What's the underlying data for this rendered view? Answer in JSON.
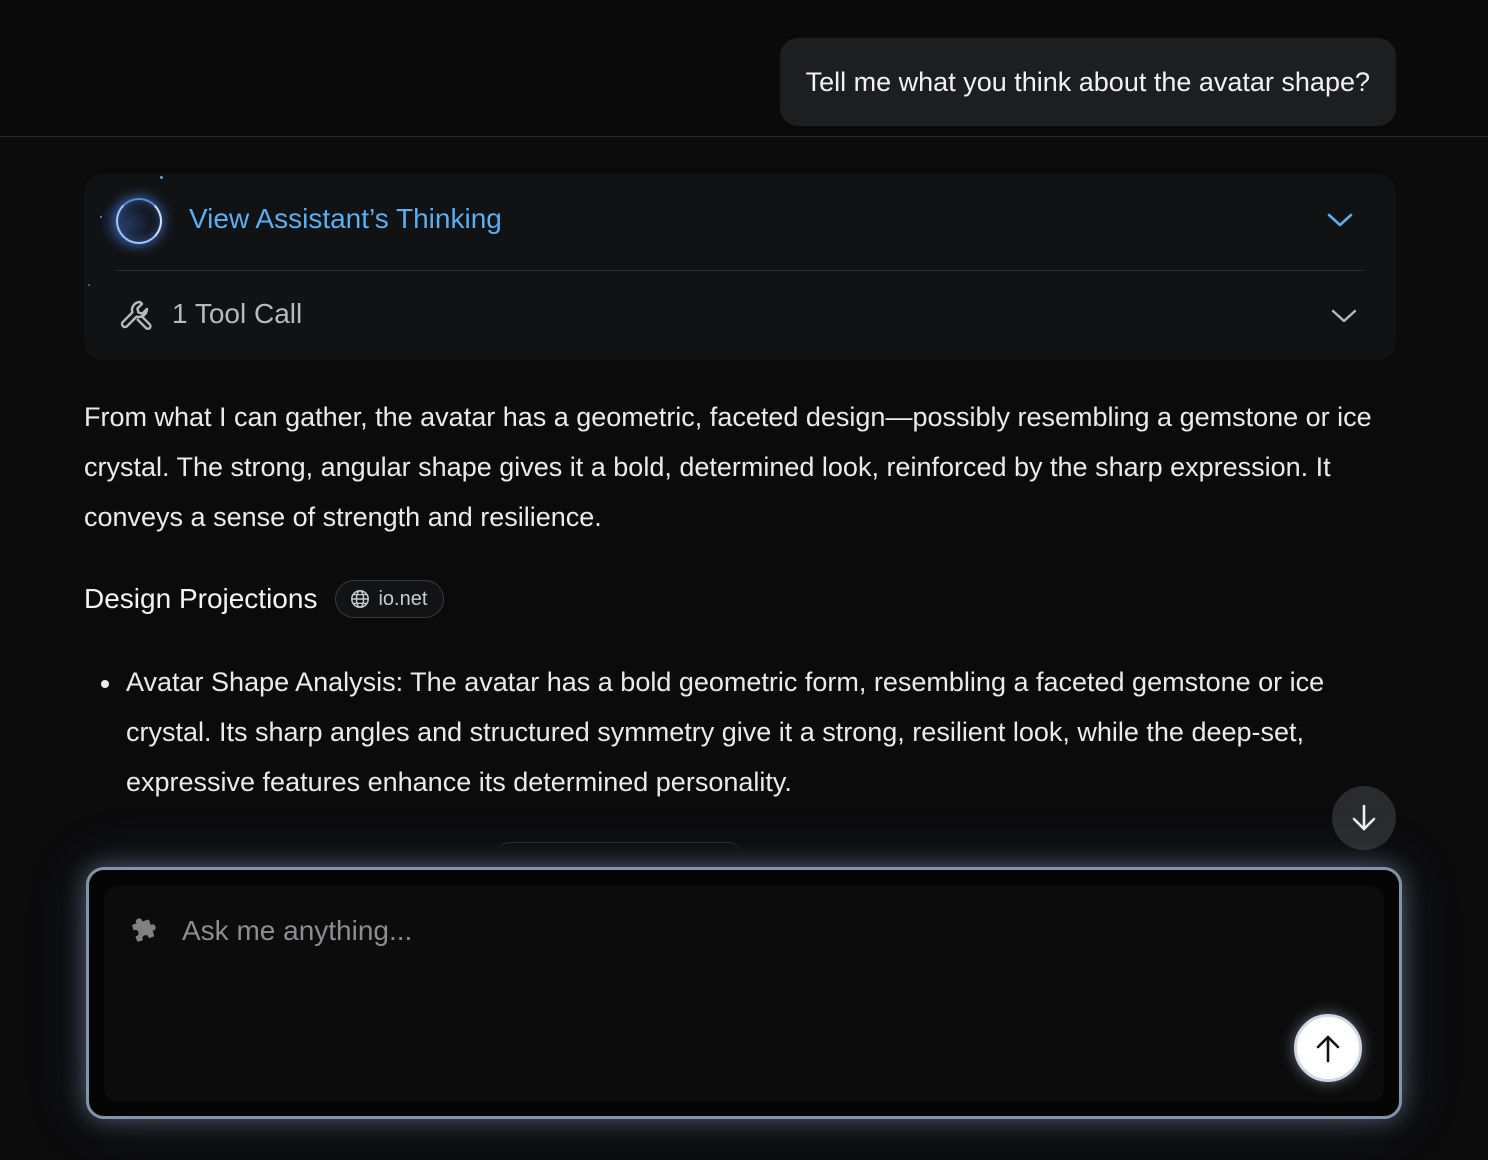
{
  "user_message": {
    "text": "Tell me what you think about the avatar shape?"
  },
  "assistant": {
    "thinking_label": "View Assistant’s Thinking",
    "tool_calls_label": "1 Tool Call",
    "answer_paragraph": "From what I can gather, the avatar has a geometric, faceted design—possibly resembling a gemstone or ice crystal. The strong, angular shape gives it a bold, determined look, reinforced by the sharp expression. It conveys a sense of strength and resilience.",
    "section_heading": "Design Projections",
    "source_chip": "io.net",
    "bullets": [
      {
        "text": "Avatar Shape Analysis: The avatar has a bold geometric form, resembling a faceted gemstone or ice crystal. Its sharp angles and structured symmetry give it a strong, resilient look, while the deep-set, expressive features enhance its determined personality."
      }
    ]
  },
  "composer": {
    "placeholder": "Ask me anything...",
    "value": ""
  },
  "icons": {
    "thinking": "glowing-orb-icon",
    "thinking_toggle": "chevron-down-icon",
    "tool": "wrench-icon",
    "tool_toggle": "chevron-down-icon",
    "source": "globe-icon",
    "scroll": "arrow-down-icon",
    "composer": "puzzle-icon",
    "send": "arrow-up-icon"
  },
  "colors": {
    "background": "#0b0b0c",
    "accent_blue": "#5aaef2",
    "user_bubble": "#1d1e20",
    "card": "#111214",
    "composer_border": "#8494a8"
  }
}
